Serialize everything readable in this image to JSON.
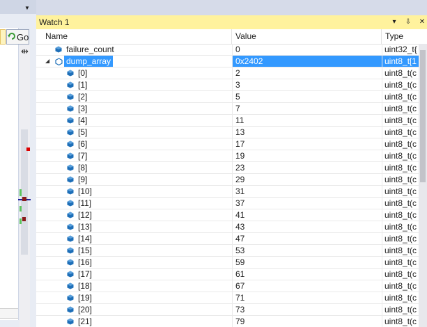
{
  "left_panel": {
    "go_label": "Go",
    "dropdown_glyph": "▼",
    "split_glyph": "⇹"
  },
  "watch": {
    "title": "Watch 1",
    "buttons": {
      "dropdown": "▾",
      "pin": "⇩",
      "close": "✕"
    },
    "columns": {
      "name": "Name",
      "value": "Value",
      "type": "Type"
    },
    "rows": [
      {
        "name": "failure_count",
        "value": "0",
        "type": "uint32_t{",
        "indent": 1,
        "expander": "",
        "selected": false
      },
      {
        "name": "dump_array",
        "value": "0x2402",
        "type": "uint8_t[1",
        "indent": 0,
        "expander": "◢",
        "selected": true
      },
      {
        "name": "[0]",
        "value": "2",
        "type": "uint8_t(c",
        "indent": 2,
        "expander": "",
        "selected": false
      },
      {
        "name": "[1]",
        "value": "3",
        "type": "uint8_t(c",
        "indent": 2,
        "expander": "",
        "selected": false
      },
      {
        "name": "[2]",
        "value": "5",
        "type": "uint8_t(c",
        "indent": 2,
        "expander": "",
        "selected": false
      },
      {
        "name": "[3]",
        "value": "7",
        "type": "uint8_t(c",
        "indent": 2,
        "expander": "",
        "selected": false
      },
      {
        "name": "[4]",
        "value": "11",
        "type": "uint8_t(c",
        "indent": 2,
        "expander": "",
        "selected": false
      },
      {
        "name": "[5]",
        "value": "13",
        "type": "uint8_t(c",
        "indent": 2,
        "expander": "",
        "selected": false
      },
      {
        "name": "[6]",
        "value": "17",
        "type": "uint8_t(c",
        "indent": 2,
        "expander": "",
        "selected": false
      },
      {
        "name": "[7]",
        "value": "19",
        "type": "uint8_t(c",
        "indent": 2,
        "expander": "",
        "selected": false
      },
      {
        "name": "[8]",
        "value": "23",
        "type": "uint8_t(c",
        "indent": 2,
        "expander": "",
        "selected": false
      },
      {
        "name": "[9]",
        "value": "29",
        "type": "uint8_t(c",
        "indent": 2,
        "expander": "",
        "selected": false
      },
      {
        "name": "[10]",
        "value": "31",
        "type": "uint8_t(c",
        "indent": 2,
        "expander": "",
        "selected": false
      },
      {
        "name": "[11]",
        "value": "37",
        "type": "uint8_t(c",
        "indent": 2,
        "expander": "",
        "selected": false
      },
      {
        "name": "[12]",
        "value": "41",
        "type": "uint8_t(c",
        "indent": 2,
        "expander": "",
        "selected": false
      },
      {
        "name": "[13]",
        "value": "43",
        "type": "uint8_t(c",
        "indent": 2,
        "expander": "",
        "selected": false
      },
      {
        "name": "[14]",
        "value": "47",
        "type": "uint8_t(c",
        "indent": 2,
        "expander": "",
        "selected": false
      },
      {
        "name": "[15]",
        "value": "53",
        "type": "uint8_t(c",
        "indent": 2,
        "expander": "",
        "selected": false
      },
      {
        "name": "[16]",
        "value": "59",
        "type": "uint8_t(c",
        "indent": 2,
        "expander": "",
        "selected": false
      },
      {
        "name": "[17]",
        "value": "61",
        "type": "uint8_t(c",
        "indent": 2,
        "expander": "",
        "selected": false
      },
      {
        "name": "[18]",
        "value": "67",
        "type": "uint8_t(c",
        "indent": 2,
        "expander": "",
        "selected": false
      },
      {
        "name": "[19]",
        "value": "71",
        "type": "uint8_t(c",
        "indent": 2,
        "expander": "",
        "selected": false
      },
      {
        "name": "[20]",
        "value": "73",
        "type": "uint8_t(c",
        "indent": 2,
        "expander": "",
        "selected": false
      },
      {
        "name": "[21]",
        "value": "79",
        "type": "uint8_t(c",
        "indent": 2,
        "expander": "",
        "selected": false
      }
    ]
  },
  "colors": {
    "title_bar": "#fff29d",
    "selection": "#3399ff",
    "variable_icon": "#1e6fb8"
  }
}
